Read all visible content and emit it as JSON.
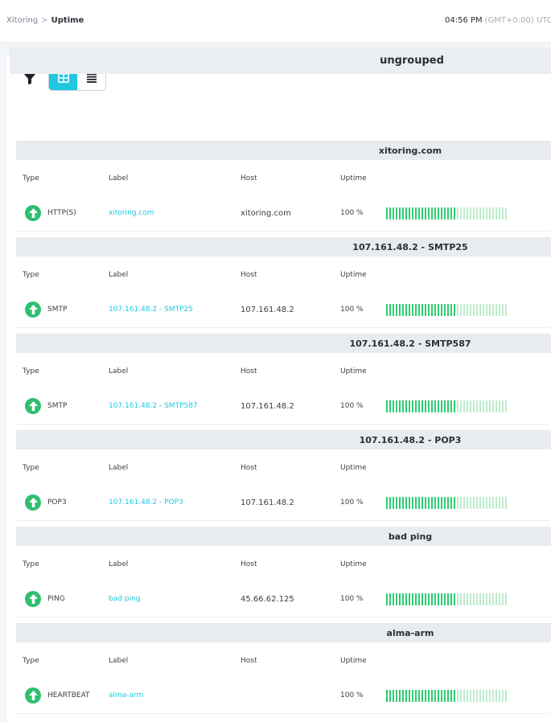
{
  "breadcrumb": {
    "root": "Xitoring",
    "separator": ">",
    "current": "Uptime"
  },
  "clock": {
    "time": "04:56 PM",
    "timezone": "(GMT+0:00) UTC"
  },
  "toolbar": {
    "filter_icon": "filter-icon",
    "grid_icon": "grid-view-icon",
    "list_icon": "list-view-icon",
    "active_view": "grid"
  },
  "group": {
    "name": "ungrouped"
  },
  "columns": {
    "type": "Type",
    "label": "Label",
    "host": "Host",
    "uptime": "Uptime"
  },
  "colors": {
    "accent": "#1ec8e1",
    "status_up": "#2fbf71",
    "bar_recent": "#2ecc71",
    "bar_older": "#bdeccc"
  },
  "monitors": [
    {
      "title": "xitoring.com",
      "type": "HTTP(S)",
      "label": "xitoring.com",
      "host": "xitoring.com",
      "uptime": "100 %",
      "status_icon": "arrow-up-icon",
      "status": "up"
    },
    {
      "title": "107.161.48.2 - SMTP25",
      "type": "SMTP",
      "label": "107.161.48.2 - SMTP25",
      "host": "107.161.48.2",
      "uptime": "100 %",
      "status_icon": "arrow-up-icon",
      "status": "up"
    },
    {
      "title": "107.161.48.2 - SMTP587",
      "type": "SMTP",
      "label": "107.161.48.2 - SMTP587",
      "host": "107.161.48.2",
      "uptime": "100 %",
      "status_icon": "arrow-up-icon",
      "status": "up"
    },
    {
      "title": "107.161.48.2 - POP3",
      "type": "POP3",
      "label": "107.161.48.2 - POP3",
      "host": "107.161.48.2",
      "uptime": "100 %",
      "status_icon": "arrow-up-icon",
      "status": "up"
    },
    {
      "title": "bad ping",
      "type": "PING",
      "label": "bad ping",
      "host": "45.66.62.125",
      "uptime": "100 %",
      "status_icon": "arrow-up-icon",
      "status": "up"
    },
    {
      "title": "alma-arm",
      "type": "HEARTBEAT",
      "label": "alma-arm",
      "host": "",
      "uptime": "100 %",
      "status_icon": "arrow-up-icon",
      "status": "up"
    }
  ]
}
